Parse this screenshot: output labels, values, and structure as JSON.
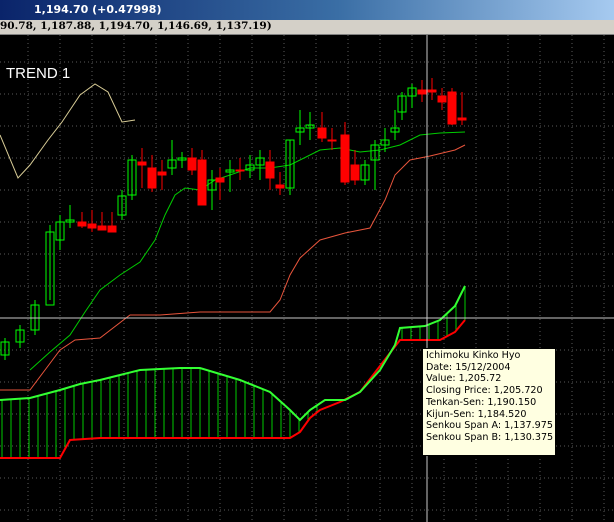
{
  "header": {
    "title": "1,194.70 (+0.47998)"
  },
  "infobar": {
    "text": "90.78, 1,187.88, 1,194.70, 1,146.69, 1,137.19)"
  },
  "chart_label": "TREND 1",
  "tooltip": {
    "title": "Ichimoku Kinko Hyo",
    "date": "Date: 15/12/2004",
    "value": "Value: 1,205.72",
    "closing": "Closing Price: 1,205.720",
    "tenkan": "Tenkan-Sen: 1,190.150",
    "kijun": "Kijun-Sen: 1,184.520",
    "span_a": "Senkou Span A: 1,137.975",
    "span_b": "Senkou Span B: 1,130.375"
  },
  "colors": {
    "background": "#000000",
    "grid": "#5a5a5a",
    "up": "#00ff00",
    "down": "#ff0000",
    "tenkan": "#00cc00",
    "kijun": "#e8553c",
    "chikou": "#d8cc96",
    "span_a": "#33ff33",
    "span_b": "#ff0000",
    "cloud": "#00cc00"
  },
  "chart_data": {
    "type": "candlestick",
    "series": [
      {
        "name": "Ichimoku Kinko Hyo"
      }
    ]
  }
}
